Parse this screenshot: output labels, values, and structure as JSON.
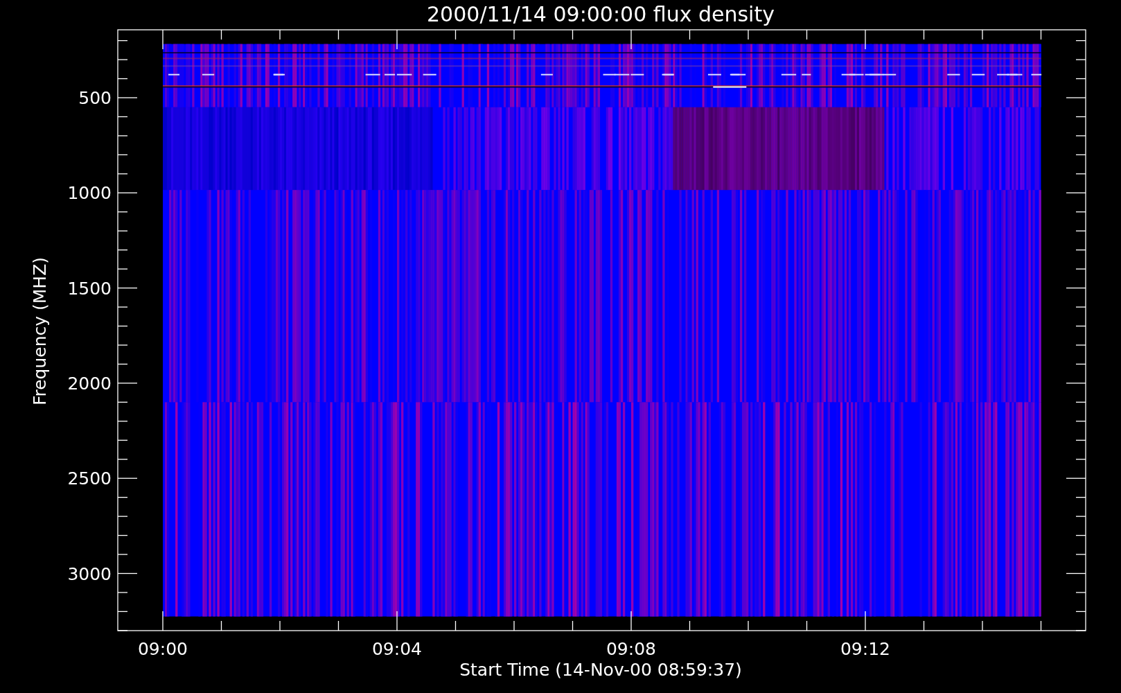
{
  "plot": {
    "title": "2000/11/14 09:00:00 flux density",
    "xlabel": "Start Time (14-Nov-00 08:59:37)",
    "ylabel": "Frequency (MHZ)",
    "y_tick_labels": [
      "500",
      "1000",
      "1500",
      "2000",
      "2500",
      "3000"
    ],
    "x_tick_labels": [
      "09:00",
      "09:04",
      "09:08",
      "09:12"
    ]
  }
}
